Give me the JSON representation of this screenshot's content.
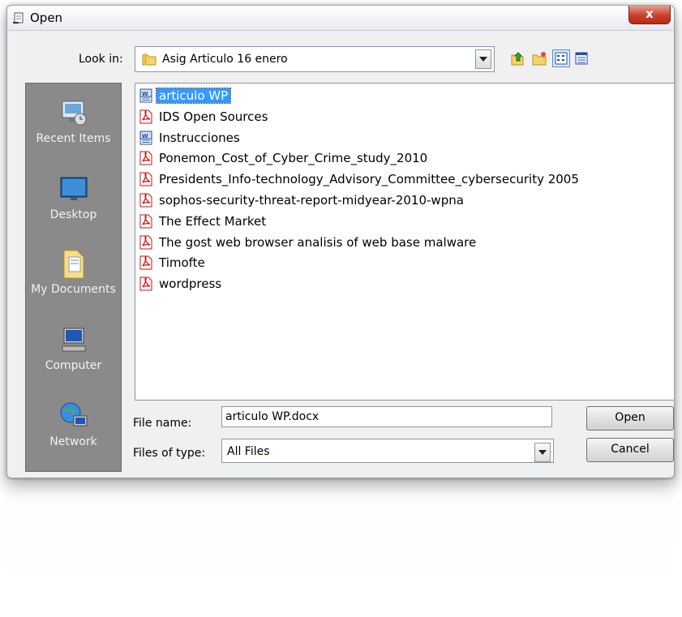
{
  "window": {
    "title": "Open",
    "close_label": "x"
  },
  "lookin": {
    "label": "Look in:",
    "value": "Asig Articulo 16 enero"
  },
  "toolbar": {
    "icons": [
      "up-one-level-icon",
      "new-folder-icon",
      "list-view-icon",
      "details-view-icon"
    ]
  },
  "places": [
    {
      "label": "Recent Items",
      "icon": "recent-items-icon"
    },
    {
      "label": "Desktop",
      "icon": "desktop-icon"
    },
    {
      "label": "My Documents",
      "icon": "my-documents-icon"
    },
    {
      "label": "Computer",
      "icon": "computer-icon"
    },
    {
      "label": "Network",
      "icon": "network-icon"
    }
  ],
  "files": [
    {
      "name": "articulo WP",
      "type": "word",
      "selected": true
    },
    {
      "name": "IDS Open Sources",
      "type": "pdf"
    },
    {
      "name": "Instrucciones",
      "type": "word"
    },
    {
      "name": "Ponemon_Cost_of_Cyber_Crime_study_2010",
      "type": "pdf"
    },
    {
      "name": "Presidents_Info-technology_Advisory_Committee_cybersecurity 2005",
      "type": "pdf"
    },
    {
      "name": "sophos-security-threat-report-midyear-2010-wpna",
      "type": "pdf"
    },
    {
      "name": "The Effect Market",
      "type": "pdf"
    },
    {
      "name": "The gost web browser analisis of web base malware",
      "type": "pdf"
    },
    {
      "name": "Timofte",
      "type": "pdf"
    },
    {
      "name": "wordpress",
      "type": "pdf"
    }
  ],
  "filename": {
    "label": "File name:",
    "value": "articulo WP.docx"
  },
  "filetype": {
    "label": "Files of type:",
    "value": "All Files"
  },
  "buttons": {
    "open": "Open",
    "cancel": "Cancel"
  },
  "colors": {
    "selection": "#3399ff",
    "places_bg": "#8a8a8a",
    "pdf_red": "#cc1111",
    "word_blue": "#1f4fa8"
  }
}
